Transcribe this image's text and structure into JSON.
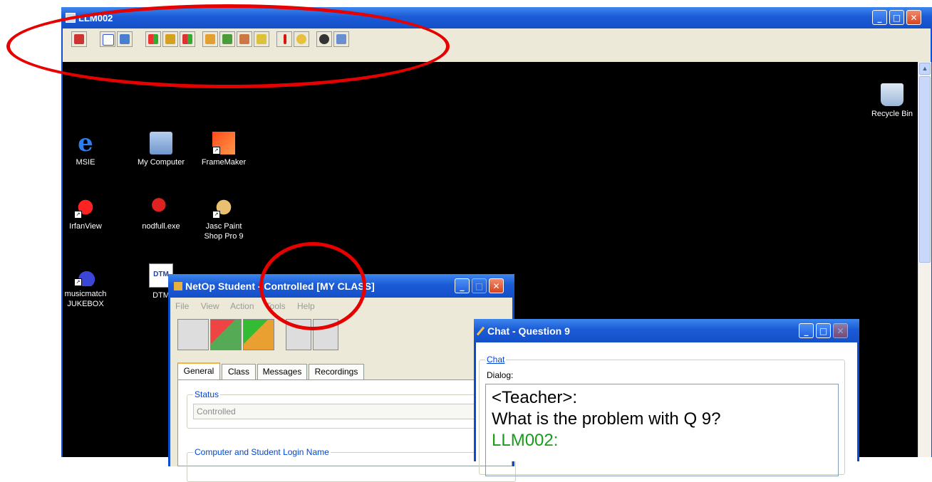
{
  "main_window": {
    "title": "LLM002",
    "toolbar_icons": [
      "exit-icon",
      "checklist-icon",
      "monitor-icon",
      "windows-logo-icon",
      "tools-icon",
      "transfer-icon",
      "group-add-icon",
      "group-move-icon",
      "users-icon",
      "users-edit-icon",
      "pen-icon",
      "lock-search-icon",
      "speaker-icon",
      "hand-icon"
    ]
  },
  "desktop": {
    "icons": [
      {
        "label": "MSIE"
      },
      {
        "label": "My Computer"
      },
      {
        "label": "FrameMaker"
      },
      {
        "label": "IrfanView"
      },
      {
        "label": "nodfull.exe"
      },
      {
        "label": "Jasc Paint Shop Pro 9"
      },
      {
        "label": "musicmatch JUKEBOX"
      },
      {
        "label": "DTM"
      },
      {
        "label": "Recycle Bin"
      }
    ],
    "dtm_badge": "DTM"
  },
  "netop": {
    "title": "NetOp Student - Controlled [MY CLASS]",
    "menu": [
      "File",
      "View",
      "Action",
      "Tools",
      "Help"
    ],
    "tabs": [
      "General",
      "Class",
      "Messages",
      "Recordings"
    ],
    "status_label": "Status",
    "status_value": "Controlled",
    "login_label": "Computer and Student Login Name"
  },
  "chat": {
    "title": "Chat - Question 9",
    "group_label": "Chat",
    "dialog_label": "Dialog:",
    "messages": [
      {
        "text": "<Teacher>:",
        "color": "#000000"
      },
      {
        "text": "What is the problem with Q 9?",
        "color": "#000000"
      },
      {
        "text": "LLM002:",
        "color": "#1a9b1a"
      }
    ]
  },
  "colors": {
    "accent": "#1450c8",
    "highlight_circle": "#e60000",
    "desktop": "#000000",
    "chat_user": "#1a9b1a"
  }
}
